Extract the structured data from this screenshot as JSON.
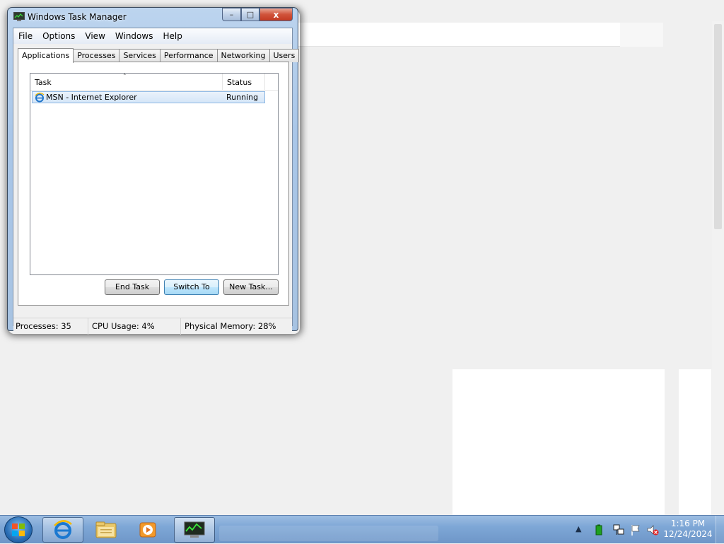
{
  "window": {
    "title": "Windows Task Manager",
    "controls": {
      "minimize": "–",
      "maximize": "□",
      "close": "x"
    }
  },
  "menu": [
    "File",
    "Options",
    "View",
    "Windows",
    "Help"
  ],
  "tabs": [
    {
      "label": "Applications",
      "active": true
    },
    {
      "label": "Processes",
      "active": false
    },
    {
      "label": "Services",
      "active": false
    },
    {
      "label": "Performance",
      "active": false
    },
    {
      "label": "Networking",
      "active": false
    },
    {
      "label": "Users",
      "active": false
    }
  ],
  "applications": {
    "columns": {
      "task": "Task",
      "status": "Status"
    },
    "sort_arrow": "˄",
    "rows": [
      {
        "task": "MSN - Internet Explorer",
        "status": "Running",
        "icon": "ie-icon",
        "selected": true
      }
    ],
    "buttons": {
      "end_task": "End Task",
      "switch_to": "Switch To",
      "new_task": "New Task..."
    }
  },
  "statusbar": {
    "processes": "Processes: 35",
    "cpu": "CPU Usage: 4%",
    "memory": "Physical Memory: 28%"
  },
  "taskbar": {
    "pinned": [
      "internet-explorer",
      "windows-explorer",
      "windows-media-player",
      "task-manager"
    ],
    "tray_chevron": "▲",
    "clock": {
      "time": "1:16 PM",
      "date": "12/24/2024"
    }
  },
  "colors": {
    "selection_bg": "#d5e6f8",
    "selection_border": "#8fb8e3",
    "close_button": "#c33a22",
    "taskbar": "#7ea7d6"
  }
}
